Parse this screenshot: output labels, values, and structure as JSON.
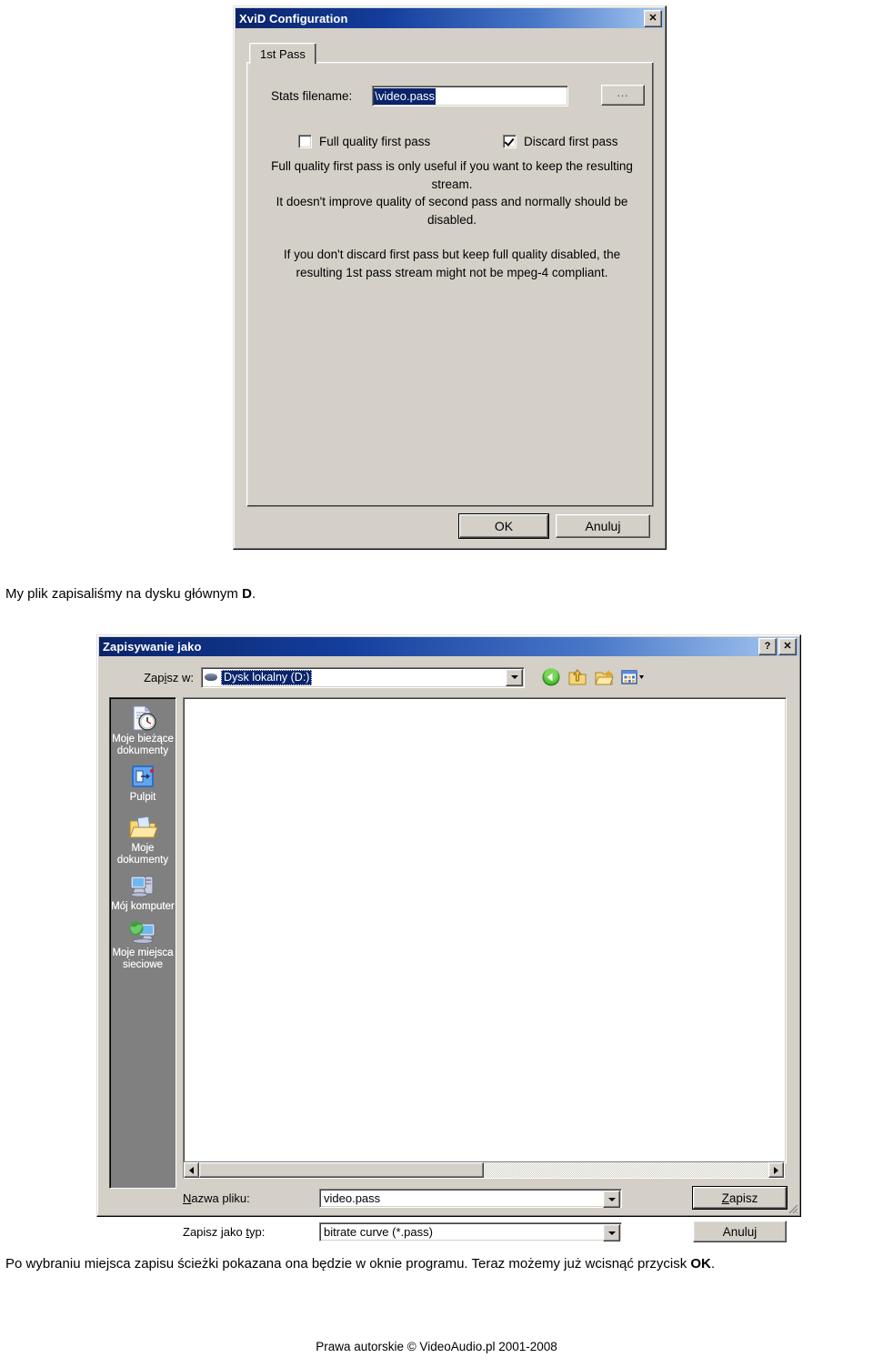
{
  "xvid_dialog": {
    "title": "XviD Configuration",
    "close_label": "✕",
    "tab_label": "1st Pass",
    "stats_label": "Stats filename:",
    "stats_value": "\\video.pass",
    "browse_label": "...",
    "checkbox_full_quality": {
      "label": "Full quality first pass",
      "checked": false
    },
    "checkbox_discard": {
      "label": "Discard first pass",
      "checked": true
    },
    "help_paragraph_1": "Full quality first pass is only useful if you want to keep the resulting stream.",
    "help_paragraph_2": "It doesn't improve quality of second pass and normally should be disabled.",
    "help_paragraph_3": "If you don't discard first pass but keep full quality disabled, the resulting 1st pass stream might not be mpeg-4 compliant.",
    "ok_label": "OK",
    "cancel_label": "Anuluj"
  },
  "paragraph_1": {
    "text_before": "My plik zapisaliśmy na dysku głównym ",
    "bold": "D",
    "text_after": "."
  },
  "save_dialog": {
    "title": "Zapisywanie jako",
    "help_label": "?",
    "close_label": "✕",
    "lookin_label_pre": "Zap",
    "lookin_label_key": "i",
    "lookin_label_post": "sz w:",
    "lookin_value": "Dysk lokalny (D:)",
    "toolbar": [
      {
        "name": "back-icon",
        "tip": "Wstecz"
      },
      {
        "name": "up-one-level-icon",
        "tip": "W górę o jeden poziom"
      },
      {
        "name": "new-folder-icon",
        "tip": "Utwórz nowy folder"
      },
      {
        "name": "views-icon",
        "tip": "Widoki"
      }
    ],
    "places": [
      {
        "label": "Moje bieżące\ndokumenty",
        "icon": "recent-documents-icon"
      },
      {
        "label": "Pulpit",
        "icon": "desktop-icon"
      },
      {
        "label": "Moje\ndokumenty",
        "icon": "my-documents-icon"
      },
      {
        "label": "Mój komputer",
        "icon": "my-computer-icon"
      },
      {
        "label": "Moje miejsca\nsieciowe",
        "icon": "network-places-icon"
      }
    ],
    "filename_label_pre": "N",
    "filename_label_post": "azwa pliku:",
    "filename_value": "video.pass",
    "filetype_label_pre": "Zapisz jako ",
    "filetype_label_key": "t",
    "filetype_label_post": "yp:",
    "filetype_value": "bitrate curve (*.pass)",
    "save_label_pre": "Z",
    "save_label_post": "apisz",
    "cancel_label": "Anuluj"
  },
  "paragraph_2": {
    "text_before": "Po wybraniu miejsca zapisu ścieżki pokazana ona będzie w oknie programu. Teraz możemy już wcisnąć przycisk ",
    "bold": "OK",
    "text_after": "."
  },
  "footer": {
    "text": "Prawa autorskie © VideoAudio.pl 2001-2008"
  },
  "colors": {
    "titlebar_start": "#0a246a",
    "titlebar_end": "#a6c8f0",
    "face": "#d4d0c8",
    "selection": "#0a246a",
    "places_bar": "#808080"
  }
}
